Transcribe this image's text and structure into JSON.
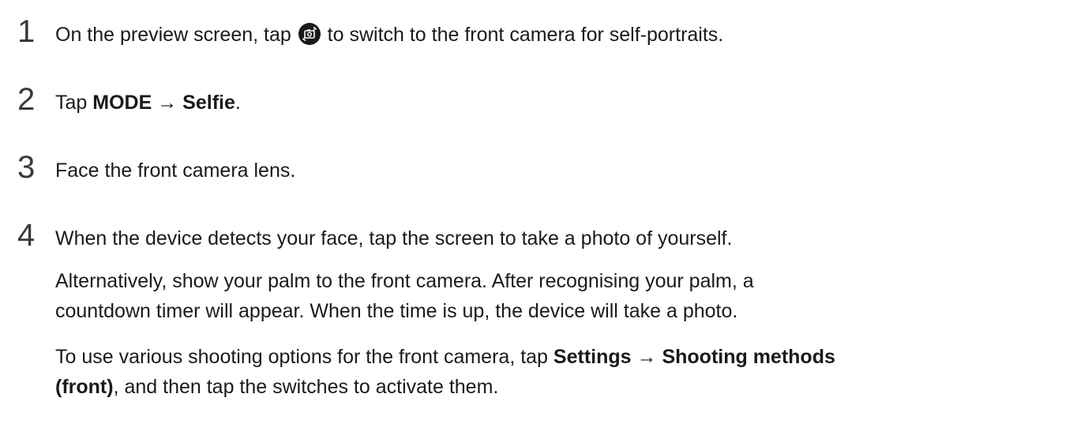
{
  "steps": [
    {
      "number": "1",
      "before_icon": "On the preview screen, tap ",
      "icon": "switch-camera-icon",
      "after_icon": " to switch to the front camera for self-portraits."
    },
    {
      "number": "2",
      "prefix": "Tap ",
      "bold1": "MODE",
      "arrow": " → ",
      "bold2": "Selfie",
      "suffix": "."
    },
    {
      "number": "3",
      "text": "Face the front camera lens."
    },
    {
      "number": "4",
      "text": "When the device detects your face, tap the screen to take a photo of yourself.",
      "para1_line1": "Alternatively, show your palm to the front camera. After recognising your palm, a",
      "para1_line2": "countdown timer will appear. When the time is up, the device will take a photo.",
      "para2_prefix": "To use various shooting options for the front camera, tap ",
      "para2_bold1": "Settings",
      "para2_arrow": " → ",
      "para2_bold2": "Shooting methods",
      "para2_bold3": "(front)",
      "para2_suffix": ", and then tap the switches to activate them."
    }
  ]
}
